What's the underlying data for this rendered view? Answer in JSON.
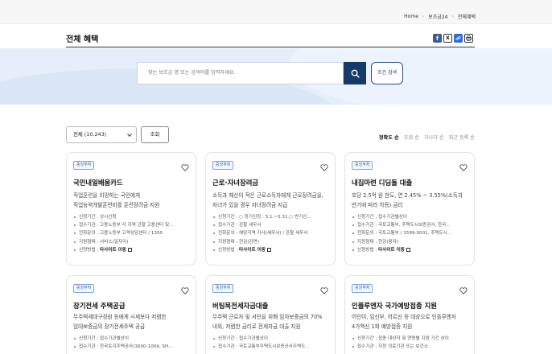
{
  "breadcrumb": {
    "home": "Home",
    "section": "보조금24",
    "current": "전체혜택"
  },
  "page": {
    "title": "전체 혜택"
  },
  "share": {
    "facebook": "f",
    "x": "X",
    "link": "🔗",
    "print": "⎙"
  },
  "search": {
    "placeholder": "찾는 보조금 명 또는 검색어를 입력하세요.",
    "cond_label": "조건 검색"
  },
  "filter": {
    "select_value": "전체 (10,243)",
    "query_label": "조회"
  },
  "sorts": [
    "정확도 순",
    "조회 순",
    "가나다 순",
    "최근 등록 순"
  ],
  "cards": [
    {
      "badge": "중앙부처",
      "title": "국민내일배움카드",
      "desc": [
        "직업훈련을 희망하는 국민에게",
        "직업능력개발훈련비를 훈련장려금 지원"
      ],
      "items": [
        "신청기간 : 상시신청",
        "접수기관 : 고용노동부 각 지역 관할 고용센터 및...",
        "전화문의 : 고용노동부 고객상담센터 / 1350",
        "지원형태 : 서비스(일자리)"
      ],
      "method_label": "신청방법 : ",
      "method_link": "타사이트 이동"
    },
    {
      "badge": "중앙부처",
      "title": "근로·자녀장려금",
      "desc": [
        "소득과 재산이 적은 근로소득자에게 근로장려금을,",
        "자녀가 있을 경우 자녀장려금 지급"
      ],
      "items": [
        "신청기간 : ○ 정기신청 : 5.1.~5.31.○ 반기신...",
        "접수기관 : 관할 세무서",
        "전화문의 : 해당지역 지사(세무서) / 관할 세무서",
        "지원형태 : 현금(감면)"
      ],
      "method_label": "신청방법 : ",
      "method_link": "타사이트 이동"
    },
    {
      "badge": "중앙부처",
      "title": "내집마련 디딤돌 대출",
      "desc": [
        "호당 2.5억 원 한도, 연 2.45% ~ 3.55%(소득과",
        "만기에 따라 차등) 금리"
      ],
      "items": [
        "신청기간 : 접수기관별상이",
        "접수기관 : 국토교통부, 주택도시보증공사, 한국...",
        "전화문의 : 국토교통부 / 1599-0001, 주택도시...",
        "지원형태 : 현금(융자)"
      ],
      "method_label": "신청방법 : ",
      "method_link": "타사이트 이동"
    },
    {
      "badge": "중앙부처",
      "title": "장기전세 주택공급",
      "desc": [
        "무주택세대구성원 등에게 시세보다 저렴한",
        "임대보증금의 장기전세주택 공급"
      ],
      "items": [
        "신청기간 : 접수기관별상이",
        "접수기관 : 한국토지주택공사(1600-1004, SH..."
      ],
      "method_label": "",
      "method_link": ""
    },
    {
      "badge": "중앙부처",
      "title": "버팀목전세자금대출",
      "desc": [
        "무주택 근로자 및 서민을 위해 임차보증금의 70%",
        "내외, 저렴한 금리로 전세자금 대출 지원"
      ],
      "items": [
        "신청기간 : 접수기관별상이",
        "접수기관 : 국토교통부주택도시보증공사주택도..."
      ],
      "method_label": "",
      "method_link": ""
    },
    {
      "badge": "중앙부처",
      "title": "인플루엔자 국가예방접종 지원",
      "desc": [
        "어린이, 임신부, 어르신 등 대상으로 인플루엔자",
        "4가백신 1회 예방접종 지원"
      ],
      "items": [
        "신청기간 : 접종 대상자 및 연령별 지원 기간 상이",
        "접수기관 : 지정 의료기관 또는 보건소"
      ],
      "method_label": "",
      "method_link": ""
    }
  ]
}
